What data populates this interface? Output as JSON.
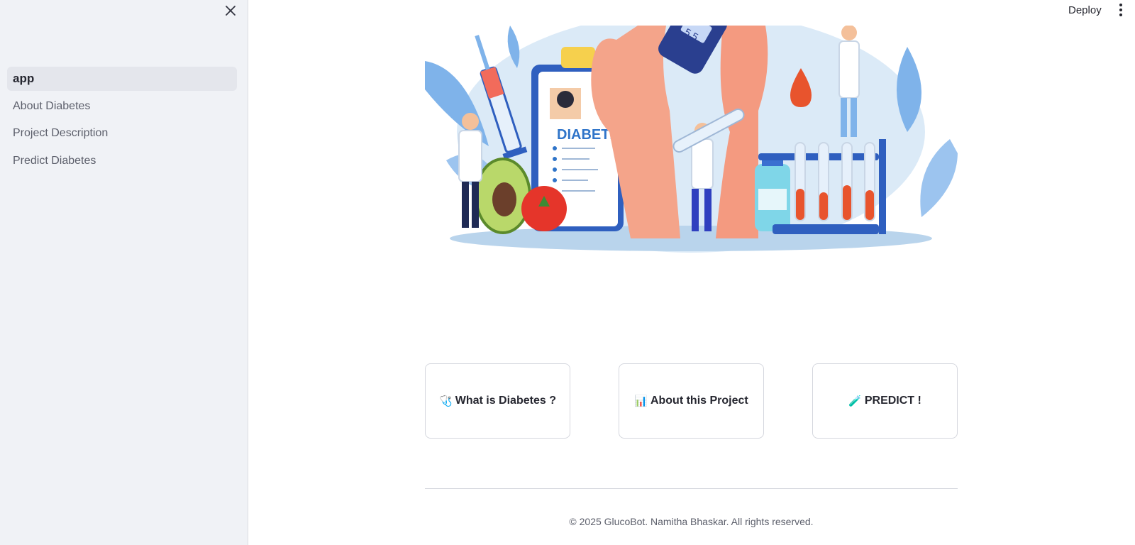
{
  "sidebar": {
    "close_icon": "close-icon",
    "items": [
      {
        "label": "app",
        "active": true
      },
      {
        "label": "About Diabetes",
        "active": false
      },
      {
        "label": "Project Description",
        "active": false
      },
      {
        "label": "Predict Diabetes",
        "active": false
      }
    ]
  },
  "topbar": {
    "deploy_label": "Deploy",
    "menu_icon": "kebab-menu-icon"
  },
  "hero": {
    "image_text": "DIABETES",
    "meter_text": "5.5"
  },
  "buttons": [
    {
      "icon": "🩺",
      "label": "What is Diabetes ?"
    },
    {
      "icon": "📊",
      "label": "About this Project"
    },
    {
      "icon": "🧪",
      "label": "PREDICT !"
    }
  ],
  "footer": {
    "text": "© 2025 GlucoBot. Namitha Bhaskar. All rights reserved."
  },
  "colors": {
    "sidebar_bg": "#f0f2f6",
    "active_item_bg": "#e4e6ec",
    "text": "#262730",
    "illustration_blue": "#2f5fbf",
    "skin": "#f4a48a",
    "blood_red": "#e8542d"
  }
}
